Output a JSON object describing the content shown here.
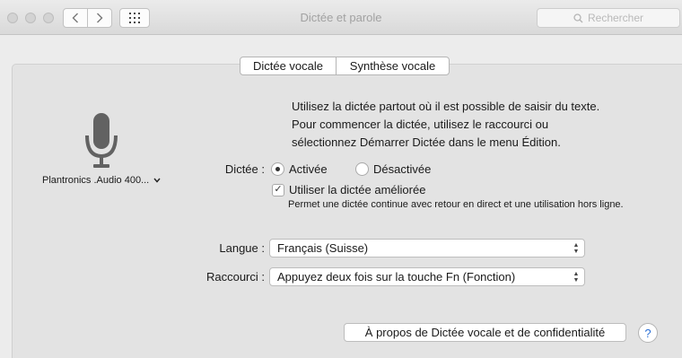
{
  "window": {
    "title": "Dictée et parole"
  },
  "search": {
    "placeholder": "Rechercher"
  },
  "tabs": [
    "Dictée vocale",
    "Synthèse vocale"
  ],
  "microphone": {
    "label": "Plantronics .Audio 400...",
    "menu_icon": "chevron-down-icon"
  },
  "description": {
    "line1": "Utilisez la dictée partout où il est possible de saisir du texte.",
    "line2": "Pour commencer la dictée, utilisez le raccourci ou",
    "line3": "sélectionnez Démarrer Dictée dans le menu Édition."
  },
  "dictee": {
    "label": "Dictée :",
    "on_label": "Activée",
    "off_label": "Désactivée",
    "selected": "Activée"
  },
  "enhanced": {
    "label": "Utiliser la dictée améliorée",
    "checked": true,
    "description": "Permet une dictée continue avec retour en direct et une utilisation hors ligne."
  },
  "langue": {
    "label": "Langue :",
    "value": "Français (Suisse)"
  },
  "raccourci": {
    "label": "Raccourci :",
    "value": "Appuyez deux fois sur la touche Fn (Fonction)"
  },
  "about_button": "À propos de Dictée vocale et de confidentialité",
  "help_button": "?"
}
